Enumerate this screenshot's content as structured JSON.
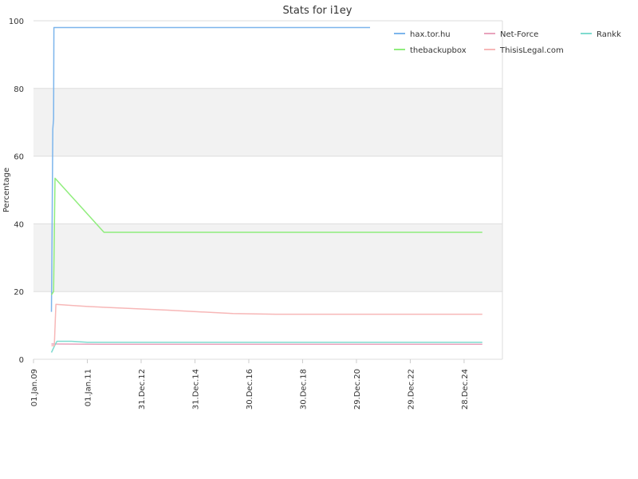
{
  "chart_data": {
    "type": "line",
    "title": "Stats for i1ey",
    "xlabel": "",
    "ylabel": "Percentage",
    "ylim": [
      0,
      100
    ],
    "yticks": [
      0,
      20,
      40,
      60,
      80,
      100
    ],
    "xlim": [
      "2009-01-01",
      "2026-06-01"
    ],
    "xticks": [
      {
        "date": "2009-01-01",
        "label": "01.Jan.09"
      },
      {
        "date": "2011-01-01",
        "label": "01.Jan.11"
      },
      {
        "date": "2012-12-31",
        "label": "31.Dec.12"
      },
      {
        "date": "2014-12-31",
        "label": "31.Dec.14"
      },
      {
        "date": "2016-12-30",
        "label": "30.Dec.16"
      },
      {
        "date": "2018-12-30",
        "label": "30.Dec.18"
      },
      {
        "date": "2020-12-29",
        "label": "29.Dec.20"
      },
      {
        "date": "2022-12-29",
        "label": "29.Dec.22"
      },
      {
        "date": "2024-12-28",
        "label": "28.Dec.24"
      }
    ],
    "grid": "horizontal bands",
    "legend_position": "top-right",
    "series": [
      {
        "name": "hax.tor.hu",
        "color": "#7cb5ec",
        "points": [
          [
            "2009-09-01",
            14
          ],
          [
            "2009-09-10",
            38
          ],
          [
            "2009-09-20",
            68
          ],
          [
            "2009-10-01",
            71
          ],
          [
            "2009-10-05",
            98
          ],
          [
            "2010-01-01",
            98
          ],
          [
            "2021-07-01",
            98
          ]
        ]
      },
      {
        "name": "Net-Force",
        "color": "#e8a3bd",
        "points": [
          [
            "2009-09-01",
            4.5
          ],
          [
            "2009-10-01",
            4.5
          ],
          [
            "2012-01-01",
            4.4
          ],
          [
            "2025-09-01",
            4.4
          ]
        ]
      },
      {
        "name": "Rankk",
        "color": "#7fdbcf",
        "points": [
          [
            "2009-09-01",
            2
          ],
          [
            "2009-10-15",
            4
          ],
          [
            "2009-11-15",
            5.3
          ],
          [
            "2010-06-01",
            5.3
          ],
          [
            "2011-01-01",
            5.0
          ],
          [
            "2025-09-01",
            5.0
          ]
        ]
      },
      {
        "name": "thebackupbox",
        "color": "#90ed7d",
        "points": [
          [
            "2009-09-01",
            19
          ],
          [
            "2009-10-01",
            20
          ],
          [
            "2009-10-20",
            53.5
          ],
          [
            "2011-08-15",
            37.5
          ],
          [
            "2025-09-01",
            37.5
          ]
        ]
      },
      {
        "name": "ThisisLegal.com",
        "color": "#f7b7b7",
        "points": [
          [
            "2009-09-01",
            4
          ],
          [
            "2009-10-10",
            4
          ],
          [
            "2009-11-01",
            16.2
          ],
          [
            "2011-01-01",
            15.6
          ],
          [
            "2014-01-01",
            14.5
          ],
          [
            "2016-06-01",
            13.5
          ],
          [
            "2018-01-01",
            13.3
          ],
          [
            "2025-09-01",
            13.3
          ]
        ]
      }
    ]
  }
}
